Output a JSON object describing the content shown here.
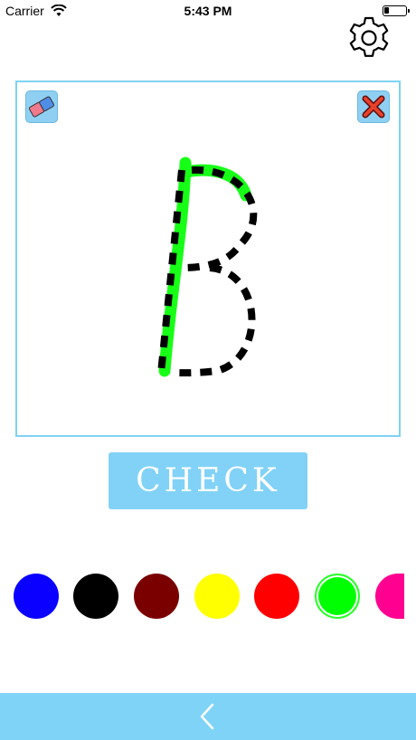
{
  "status_bar": {
    "carrier": "Carrier",
    "time": "5:43 PM"
  },
  "icons": {
    "settings": "gear-icon",
    "eraser": "eraser-icon",
    "clear": "close-icon",
    "back": "chevron-left-icon",
    "wifi": "wifi-icon",
    "battery": "battery-icon"
  },
  "tracing": {
    "letter": "B",
    "stroke_color": "#17ff17",
    "guide_color": "#000000"
  },
  "check_button": {
    "label": "CHECK"
  },
  "palette": {
    "colors": [
      "#0a00ff",
      "#000000",
      "#7a0000",
      "#ffff00",
      "#ff0000",
      "#00ff00",
      "#ff0090"
    ],
    "selected_index": 5
  },
  "colors": {
    "accent": "#7fd3f7",
    "canvas_border": "#7fd3f2"
  }
}
